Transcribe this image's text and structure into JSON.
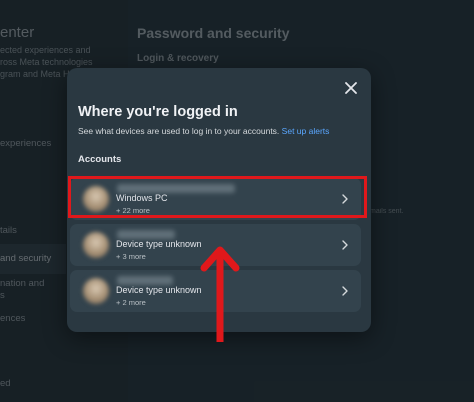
{
  "background": {
    "left_title": "enter",
    "left_desc": "ected experiences and\nross Meta technologies\ngram and Meta H",
    "left_nav": [
      {
        "label": "experiences"
      },
      {
        "label": "tails"
      },
      {
        "label": "and security"
      },
      {
        "label": "nation and\ns"
      },
      {
        "label": "ences"
      },
      {
        "label": "ed"
      }
    ],
    "right_title": "Password and security",
    "right_subtitle": "Login & recovery",
    "right_fragment": "mails sent."
  },
  "modal": {
    "title": "Where you're logged in",
    "description": "See what devices are used to log in to your accounts.",
    "link_label": "Set up alerts",
    "section_label": "Accounts",
    "accounts": [
      {
        "device": "Windows PC",
        "more": "+ 22 more"
      },
      {
        "device": "Device type unknown",
        "more": "+ 3 more"
      },
      {
        "device": "Device type unknown",
        "more": "+ 2 more"
      }
    ]
  },
  "colors": {
    "highlight": "#e0181b",
    "link": "#5aa7ff",
    "modal_bg": "#2a3841",
    "card_bg": "#33434d"
  }
}
